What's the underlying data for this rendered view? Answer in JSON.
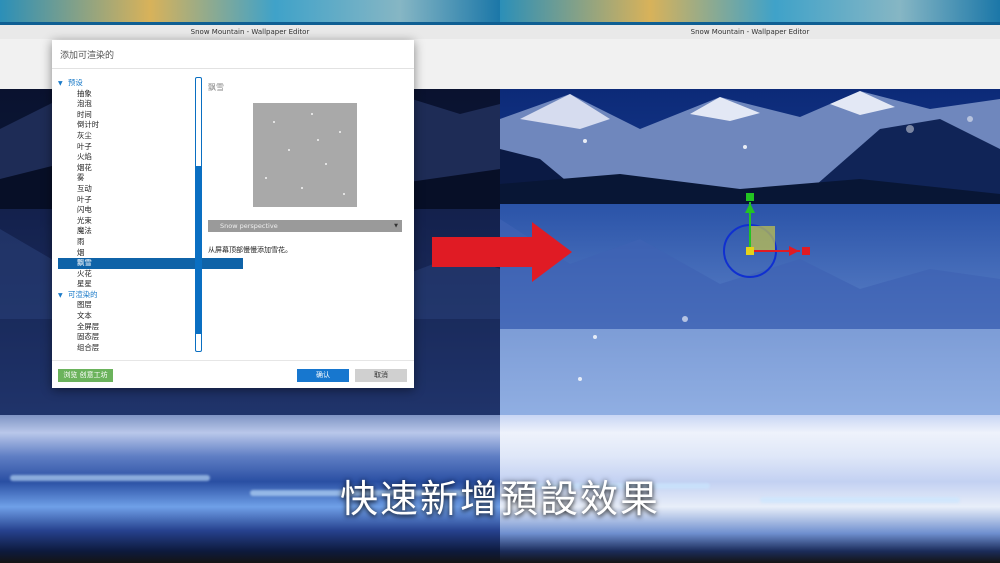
{
  "app": {
    "window_title": "Snow Mountain - Wallpaper Editor"
  },
  "dialog": {
    "title": "添加可渲染的",
    "tree": [
      {
        "label": "预设",
        "kind": "group",
        "expanded": true
      },
      {
        "label": "抽象",
        "kind": "child"
      },
      {
        "label": "泡泡",
        "kind": "child"
      },
      {
        "label": "时间",
        "kind": "child"
      },
      {
        "label": "倒计时",
        "kind": "child"
      },
      {
        "label": "灰尘",
        "kind": "child"
      },
      {
        "label": "叶子",
        "kind": "child"
      },
      {
        "label": "火焰",
        "kind": "child"
      },
      {
        "label": "烟花",
        "kind": "child"
      },
      {
        "label": "雾",
        "kind": "child"
      },
      {
        "label": "互动",
        "kind": "child"
      },
      {
        "label": "叶子",
        "kind": "child"
      },
      {
        "label": "闪电",
        "kind": "child"
      },
      {
        "label": "光束",
        "kind": "child"
      },
      {
        "label": "魔法",
        "kind": "child"
      },
      {
        "label": "雨",
        "kind": "child"
      },
      {
        "label": "烟",
        "kind": "child"
      },
      {
        "label": "飘雪",
        "kind": "child",
        "selected": true
      },
      {
        "label": "火花",
        "kind": "child"
      },
      {
        "label": "星星",
        "kind": "child"
      },
      {
        "label": "可渲染的",
        "kind": "group",
        "expanded": true
      },
      {
        "label": "图层",
        "kind": "child"
      },
      {
        "label": "文本",
        "kind": "child"
      },
      {
        "label": "全屏层",
        "kind": "child"
      },
      {
        "label": "固态层",
        "kind": "child"
      },
      {
        "label": "组合层",
        "kind": "child"
      }
    ],
    "preview": {
      "title": "飘雪",
      "selected_option": "Snow perspective",
      "description": "从屏幕顶部慢慢添加雪花。"
    },
    "buttons": {
      "workshop": "浏览 创意工坊",
      "ok": "确认",
      "cancel": "取消"
    }
  },
  "caption": "快速新增預設效果",
  "colors": {
    "accent": "#0f63a8",
    "arrow": "#e01b24",
    "workshop_button": "#6bb35c",
    "ok_button": "#1777cf"
  }
}
